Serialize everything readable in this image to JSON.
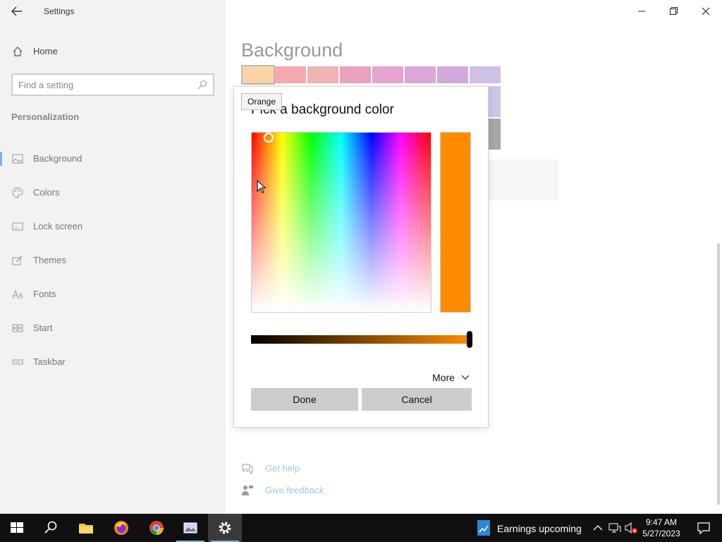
{
  "window": {
    "title": "Settings",
    "back_icon": "back-arrow-icon",
    "controls": [
      "minimize-icon",
      "restore-icon",
      "close-icon"
    ]
  },
  "sidebar": {
    "home_label": "Home",
    "search_placeholder": "Find a setting",
    "section_title": "Personalization",
    "items": [
      {
        "label": "Background",
        "icon": "image-icon",
        "active": true
      },
      {
        "label": "Colors",
        "icon": "palette-icon",
        "active": false
      },
      {
        "label": "Lock screen",
        "icon": "lock-screen-icon",
        "active": false
      },
      {
        "label": "Themes",
        "icon": "themes-icon",
        "active": false
      },
      {
        "label": "Fonts",
        "icon": "fonts-icon",
        "active": false
      },
      {
        "label": "Start",
        "icon": "start-icon",
        "active": false
      },
      {
        "label": "Taskbar",
        "icon": "taskbar-icon",
        "active": false
      }
    ]
  },
  "main": {
    "page_title": "Background",
    "swatches_row1": [
      "#fbd3a5",
      "#f4a9b0",
      "#eeb3b3",
      "#eaa2bf",
      "#e6a4cf",
      "#dca6d9",
      "#d2a9db",
      "#cfc0e6"
    ],
    "links": [
      {
        "label": "Get help",
        "icon": "help-chat-icon"
      },
      {
        "label": "Give feedback",
        "icon": "feedback-icon"
      }
    ]
  },
  "dialog": {
    "title": "Pick a background color",
    "tooltip": "Orange",
    "selected_color": "#ff8c00",
    "value_level": 1.0,
    "more_label": "More",
    "done_label": "Done",
    "cancel_label": "Cancel"
  },
  "taskbar": {
    "apps": [
      "windows-start-icon",
      "search-icon",
      "file-explorer-icon",
      "firefox-icon",
      "chrome-icon",
      "photo-app-icon",
      "settings-gear-icon"
    ],
    "news_label": "Earnings upcoming",
    "time": "9:47 AM",
    "date": "5/27/2023"
  }
}
